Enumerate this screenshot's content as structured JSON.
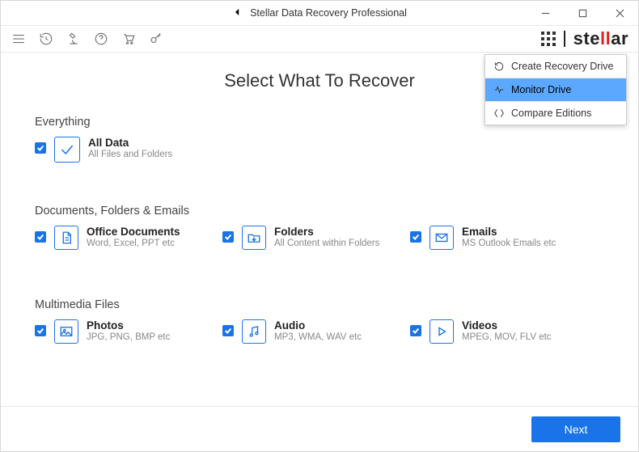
{
  "window": {
    "title": "Stellar Data Recovery Professional",
    "controls": {
      "minimize": "–",
      "maximize": "□",
      "close": "×"
    }
  },
  "brand": {
    "name": "stellar"
  },
  "page": {
    "heading": "Select What To Recover"
  },
  "sections": {
    "everything": {
      "title": "Everything",
      "items": {
        "all_data": {
          "label": "All Data",
          "sub": "All Files and Folders"
        }
      }
    },
    "docs": {
      "title": "Documents, Folders & Emails",
      "items": {
        "office": {
          "label": "Office Documents",
          "sub": "Word, Excel, PPT etc"
        },
        "folders": {
          "label": "Folders",
          "sub": "All Content within Folders"
        },
        "emails": {
          "label": "Emails",
          "sub": "MS Outlook Emails etc"
        }
      }
    },
    "media": {
      "title": "Multimedia Files",
      "items": {
        "photos": {
          "label": "Photos",
          "sub": "JPG, PNG, BMP etc"
        },
        "audio": {
          "label": "Audio",
          "sub": "MP3, WMA, WAV etc"
        },
        "videos": {
          "label": "Videos",
          "sub": "MPEG, MOV, FLV etc"
        }
      }
    }
  },
  "dropdown": {
    "items": {
      "create": "Create Recovery Drive",
      "monitor": "Monitor Drive",
      "compare": "Compare Editions"
    },
    "selected": "monitor"
  },
  "footer": {
    "next": "Next"
  }
}
